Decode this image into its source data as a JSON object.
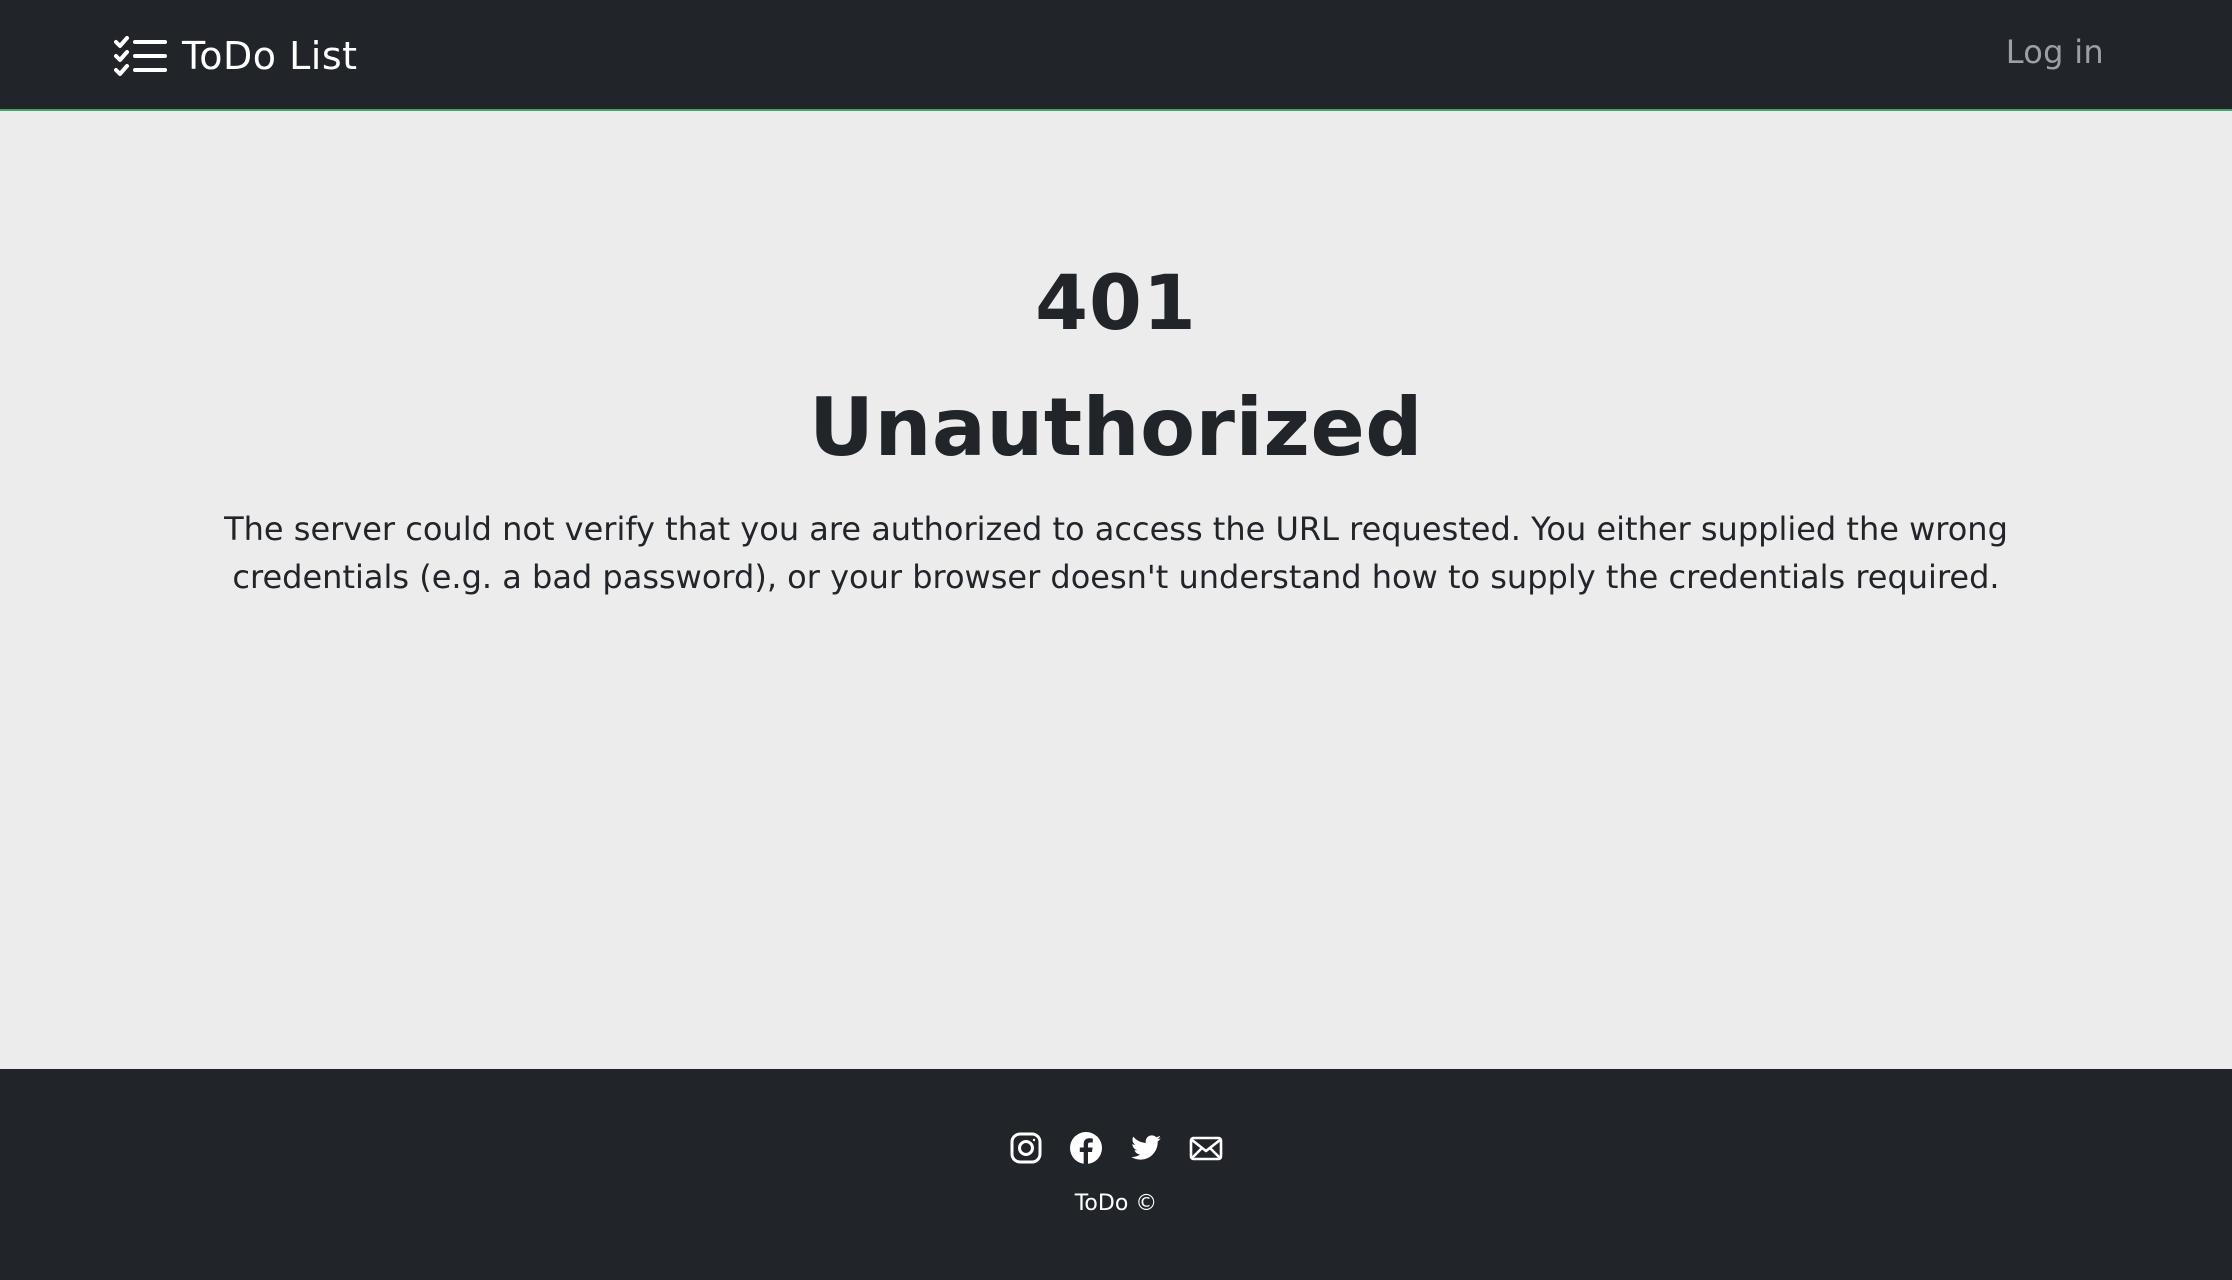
{
  "navbar": {
    "brand_icon": "checklist-icon",
    "brand_label": "ToDo List",
    "login_label": "Log in"
  },
  "error": {
    "code": "401",
    "title": "Unauthorized",
    "description": "The server could not verify that you are authorized to access the URL requested. You either supplied the wrong credentials (e.g. a bad password), or your browser doesn't understand how to supply the credentials required."
  },
  "footer": {
    "social_icons": [
      "instagram-icon",
      "facebook-icon",
      "twitter-icon",
      "mail-icon"
    ],
    "copyright": "ToDo ©"
  },
  "colors": {
    "header_footer_bg": "#212429",
    "page_bg": "#ececec",
    "accent_border": "#3ea86a",
    "login_text": "#9aa0a6",
    "text_dark": "#212429"
  }
}
